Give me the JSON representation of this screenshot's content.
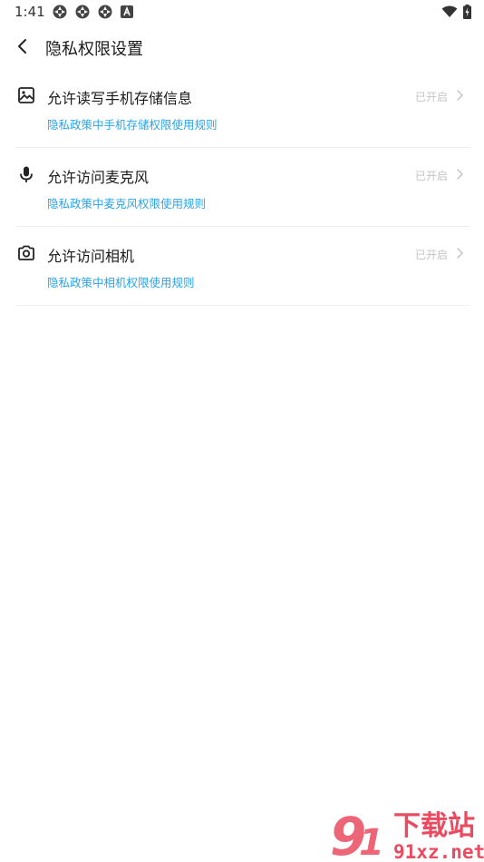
{
  "status_bar": {
    "time": "1:41",
    "notification_icons": [
      "app-notification-icon",
      "app-notification-icon",
      "app-notification-icon",
      "a-badge-icon"
    ],
    "right_icons": [
      "wifi-icon",
      "battery-icon"
    ]
  },
  "header": {
    "title": "隐私权限设置",
    "back_icon": "chevron-left-icon"
  },
  "permissions": [
    {
      "icon": "image-icon",
      "title": "允许读写手机存储信息",
      "status": "已开启",
      "link": "隐私政策中手机存储权限使用规则"
    },
    {
      "icon": "microphone-icon",
      "title": "允许访问麦克风",
      "status": "已开启",
      "link": "隐私政策中麦克风权限使用规则"
    },
    {
      "icon": "camera-icon",
      "title": "允许访问相机",
      "status": "已开启",
      "link": "隐私政策中相机权限使用规则"
    }
  ],
  "watermark": {
    "brand_text": "下载站",
    "site_text": "91xz.net",
    "logo_number": "9"
  },
  "colors": {
    "link": "#2aa4e6",
    "status": "#c4c4c4",
    "divider": "#eeeeee",
    "watermark_red": "#e8384f"
  }
}
